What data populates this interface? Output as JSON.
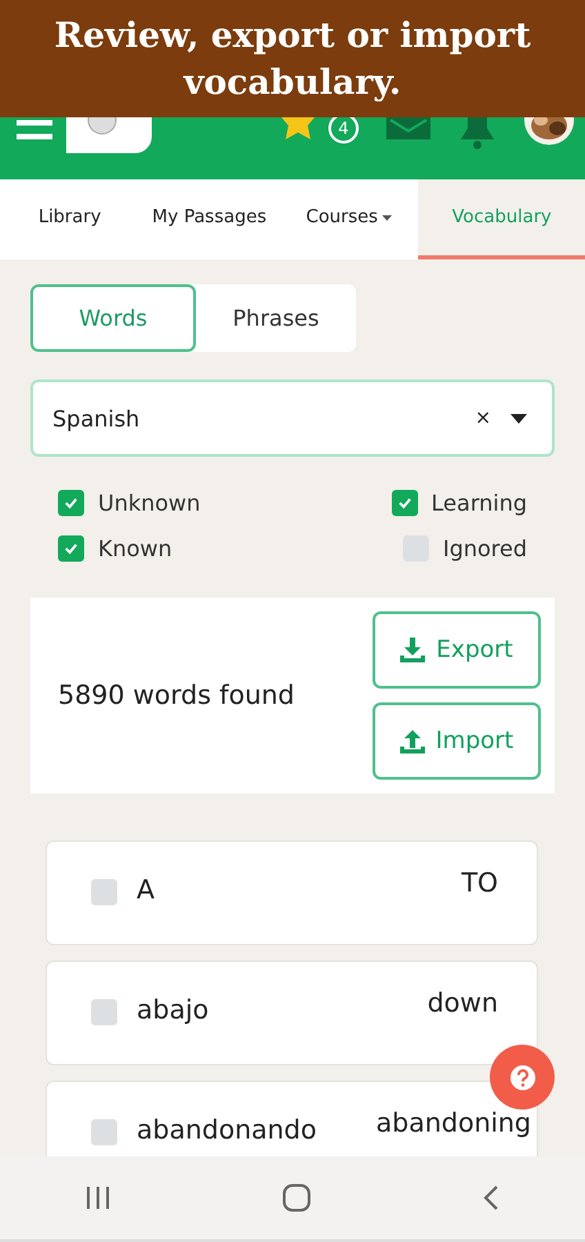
{
  "caption": "Review, export or import vocabulary.",
  "header": {
    "streak_count": "4"
  },
  "nav_tabs": [
    {
      "label": "Library",
      "selected": false,
      "dropdown": false
    },
    {
      "label": "My Passages",
      "selected": false,
      "dropdown": false
    },
    {
      "label": "Courses",
      "selected": false,
      "dropdown": true
    },
    {
      "label": "Vocabulary",
      "selected": true,
      "dropdown": false
    }
  ],
  "mode_tabs": [
    {
      "label": "Words",
      "selected": true
    },
    {
      "label": "Phrases",
      "selected": false
    }
  ],
  "language_select": {
    "value": "Spanish",
    "clear": "×"
  },
  "filters": [
    {
      "label": "Unknown",
      "checked": true
    },
    {
      "label": "Learning",
      "checked": true
    },
    {
      "label": "Known",
      "checked": true
    },
    {
      "label": "Ignored",
      "checked": false
    }
  ],
  "results": {
    "summary": "5890 words found",
    "export": "Export",
    "import": "Import"
  },
  "words": [
    {
      "term": "A",
      "translation": "TO",
      "checked": false
    },
    {
      "term": "abajo",
      "translation": "down",
      "checked": false
    },
    {
      "term": "abandonando",
      "translation": "abandoning",
      "checked": false
    }
  ]
}
